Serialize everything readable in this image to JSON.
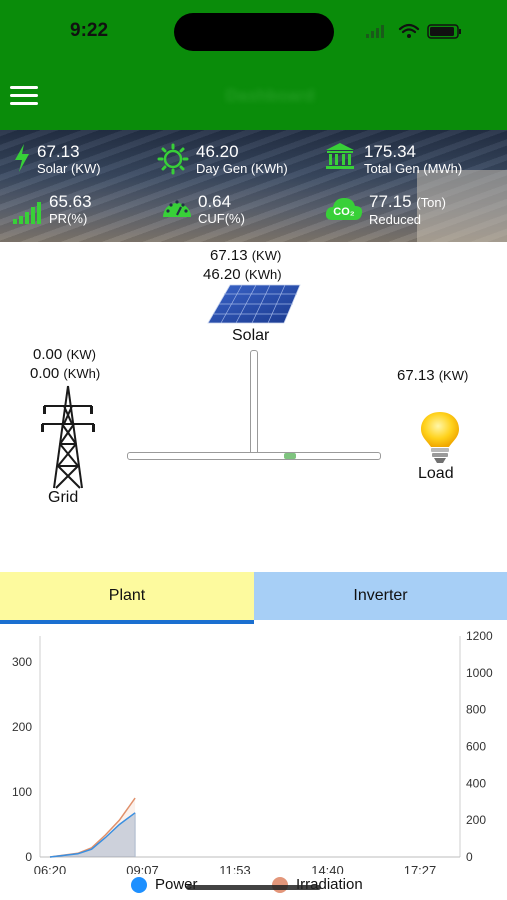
{
  "status_bar": {
    "time": "9:22"
  },
  "header": {
    "title": "Dashboard"
  },
  "stats": [
    {
      "value": "67.13",
      "label": "Solar (KW)",
      "icon": "lightning-icon"
    },
    {
      "value": "46.20",
      "label": "Day Gen (KWh)",
      "icon": "sun-icon"
    },
    {
      "value": "175.34",
      "label": "Total Gen (MWh)",
      "icon": "bank-icon"
    },
    {
      "value": "65.63",
      "label": "PR(%)",
      "icon": "signal-bars-icon"
    },
    {
      "value": "0.64",
      "label": "CUF(%)",
      "icon": "gauge-icon"
    },
    {
      "value": "77.15",
      "unit": "(Ton)",
      "label": "Reduced",
      "icon": "co2-cloud-icon",
      "icon_text": "CO₂"
    }
  ],
  "flow": {
    "solar": {
      "power": "67.13",
      "power_unit": "(KW)",
      "energy": "46.20",
      "energy_unit": "(KWh)",
      "label": "Solar"
    },
    "grid": {
      "power": "0.00",
      "power_unit": "(KW)",
      "energy": "0.00",
      "energy_unit": "(KWh)",
      "label": "Grid"
    },
    "load": {
      "power": "67.13",
      "power_unit": "(KW)",
      "label": "Load"
    }
  },
  "tabs": [
    {
      "label": "Plant",
      "active": true
    },
    {
      "label": "Inverter",
      "active": false
    }
  ],
  "chart_data": {
    "type": "area",
    "x_ticks": [
      "06:20",
      "09:07",
      "11:53",
      "14:40",
      "17:27"
    ],
    "y_left_ticks": [
      "0",
      "100",
      "200",
      "300"
    ],
    "y_right_ticks": [
      "0",
      "200",
      "400",
      "600",
      "800",
      "1000",
      "1200"
    ],
    "ylim_left": [
      0,
      340
    ],
    "ylim_right": [
      0,
      1200
    ],
    "series": [
      {
        "name": "Power",
        "axis": "left",
        "color": "#3a8fe0",
        "points": [
          [
            0,
            0
          ],
          [
            0.3,
            5
          ],
          [
            0.45,
            12
          ],
          [
            0.6,
            30
          ],
          [
            0.75,
            50
          ],
          [
            0.92,
            68
          ]
        ]
      },
      {
        "name": "Irradiation",
        "axis": "right",
        "color": "#e0906a",
        "points": [
          [
            0,
            0
          ],
          [
            0.3,
            20
          ],
          [
            0.45,
            50
          ],
          [
            0.6,
            120
          ],
          [
            0.75,
            200
          ],
          [
            0.92,
            320
          ]
        ]
      }
    ],
    "legend": [
      "Power",
      "Irradiation"
    ],
    "legend_colors": [
      "#1e90ff",
      "#e3967a"
    ]
  }
}
